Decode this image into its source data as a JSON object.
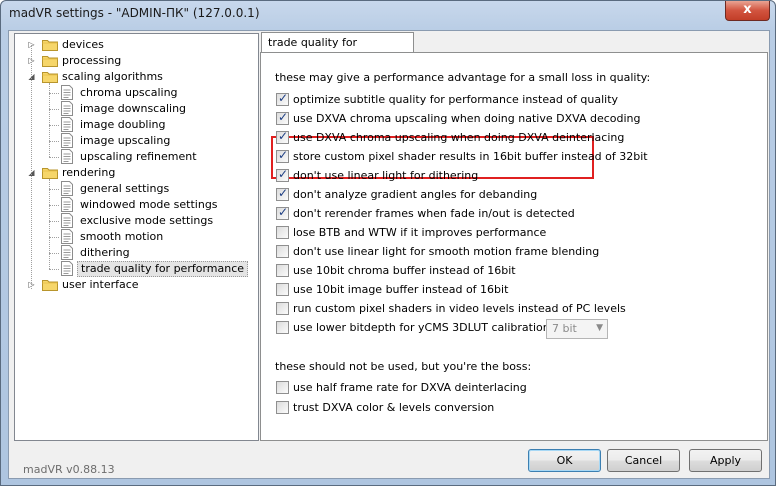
{
  "window": {
    "title": "madVR settings - \"ADMIN-ПК\" (127.0.0.1)",
    "close_label": "x"
  },
  "tree": {
    "items": [
      {
        "label": "devices",
        "level": 0,
        "type": "folder",
        "expander": "▷"
      },
      {
        "label": "processing",
        "level": 0,
        "type": "folder",
        "expander": "▷"
      },
      {
        "label": "scaling algorithms",
        "level": 0,
        "type": "folder",
        "expander": "◢"
      },
      {
        "label": "chroma upscaling",
        "level": 1,
        "type": "page"
      },
      {
        "label": "image downscaling",
        "level": 1,
        "type": "page"
      },
      {
        "label": "image doubling",
        "level": 1,
        "type": "page"
      },
      {
        "label": "image upscaling",
        "level": 1,
        "type": "page"
      },
      {
        "label": "upscaling refinement",
        "level": 1,
        "type": "page"
      },
      {
        "label": "rendering",
        "level": 0,
        "type": "folder",
        "expander": "◢"
      },
      {
        "label": "general settings",
        "level": 1,
        "type": "page"
      },
      {
        "label": "windowed mode settings",
        "level": 1,
        "type": "page"
      },
      {
        "label": "exclusive mode settings",
        "level": 1,
        "type": "page"
      },
      {
        "label": "smooth motion",
        "level": 1,
        "type": "page"
      },
      {
        "label": "dithering",
        "level": 1,
        "type": "page"
      },
      {
        "label": "trade quality for performance",
        "level": 1,
        "type": "page",
        "selected": true
      },
      {
        "label": "user interface",
        "level": 0,
        "type": "folder",
        "expander": "▷"
      }
    ]
  },
  "tab": {
    "label": "trade quality for performance"
  },
  "panel": {
    "section1_heading": "these may give a performance advantage for a small loss in quality:",
    "section2_heading": "these should not be used, but you're the boss:",
    "options": [
      {
        "label": "optimize subtitle quality for performance instead of quality",
        "checked": true
      },
      {
        "label": "use DXVA chroma upscaling when doing native DXVA decoding",
        "checked": true
      },
      {
        "label": "use DXVA chroma upscaling when doing DXVA deinterlacing",
        "checked": true
      },
      {
        "label": "store custom pixel shader results in 16bit buffer instead of 32bit",
        "checked": true
      },
      {
        "label": "don't use linear light for dithering",
        "checked": true
      },
      {
        "label": "don't analyze gradient angles for debanding",
        "checked": true
      },
      {
        "label": "don't rerender frames when fade in/out is detected",
        "checked": true
      },
      {
        "label": "lose BTB and WTW if it improves performance",
        "checked": false
      },
      {
        "label": "don't use linear light for smooth motion frame blending",
        "checked": false
      },
      {
        "label": "use 10bit chroma buffer instead of 16bit",
        "checked": false
      },
      {
        "label": "use 10bit image buffer instead of 16bit",
        "checked": false
      },
      {
        "label": "run custom pixel shaders in video levels instead of PC levels",
        "checked": false
      },
      {
        "label": "use lower bitdepth for yCMS 3DLUT calibration:",
        "checked": false
      }
    ],
    "bitdepth_select": {
      "value": "7 bit",
      "arrow": "▼"
    },
    "boss_options": [
      {
        "label": "use half frame rate for DXVA deinterlacing",
        "checked": false
      },
      {
        "label": "trust DXVA color & levels conversion",
        "checked": false
      }
    ],
    "check_mark": "✓"
  },
  "footer": {
    "version": "madVR v0.88.13",
    "ok_label": "OK",
    "cancel_label": "Cancel",
    "apply_label": "Apply"
  },
  "colors": {
    "highlight_box": "#e02020",
    "folder": "#f6d66a",
    "title_text": "#1a1a1a"
  }
}
